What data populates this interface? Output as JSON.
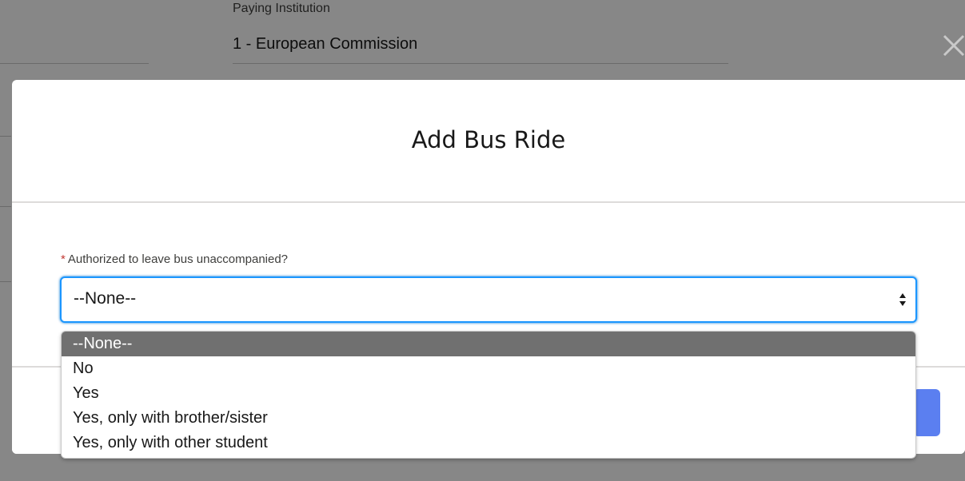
{
  "background": {
    "field_label": "Paying Institution",
    "field_value": "1 - European Commission"
  },
  "close_icon": "close-icon",
  "modal": {
    "title": "Add Bus Ride",
    "field": {
      "required_mark": "*",
      "label": "Authorized to leave bus unaccompanied?",
      "value": "--None--",
      "options": [
        "--None--",
        "No",
        "Yes",
        "Yes, only with brother/sister",
        "Yes, only with other student"
      ],
      "selected_index": 0
    }
  },
  "colors": {
    "focus_border": "#1b96ff",
    "required": "#c23934",
    "primary_button": "#5b7ff0",
    "selected_option_bg": "#707070"
  }
}
